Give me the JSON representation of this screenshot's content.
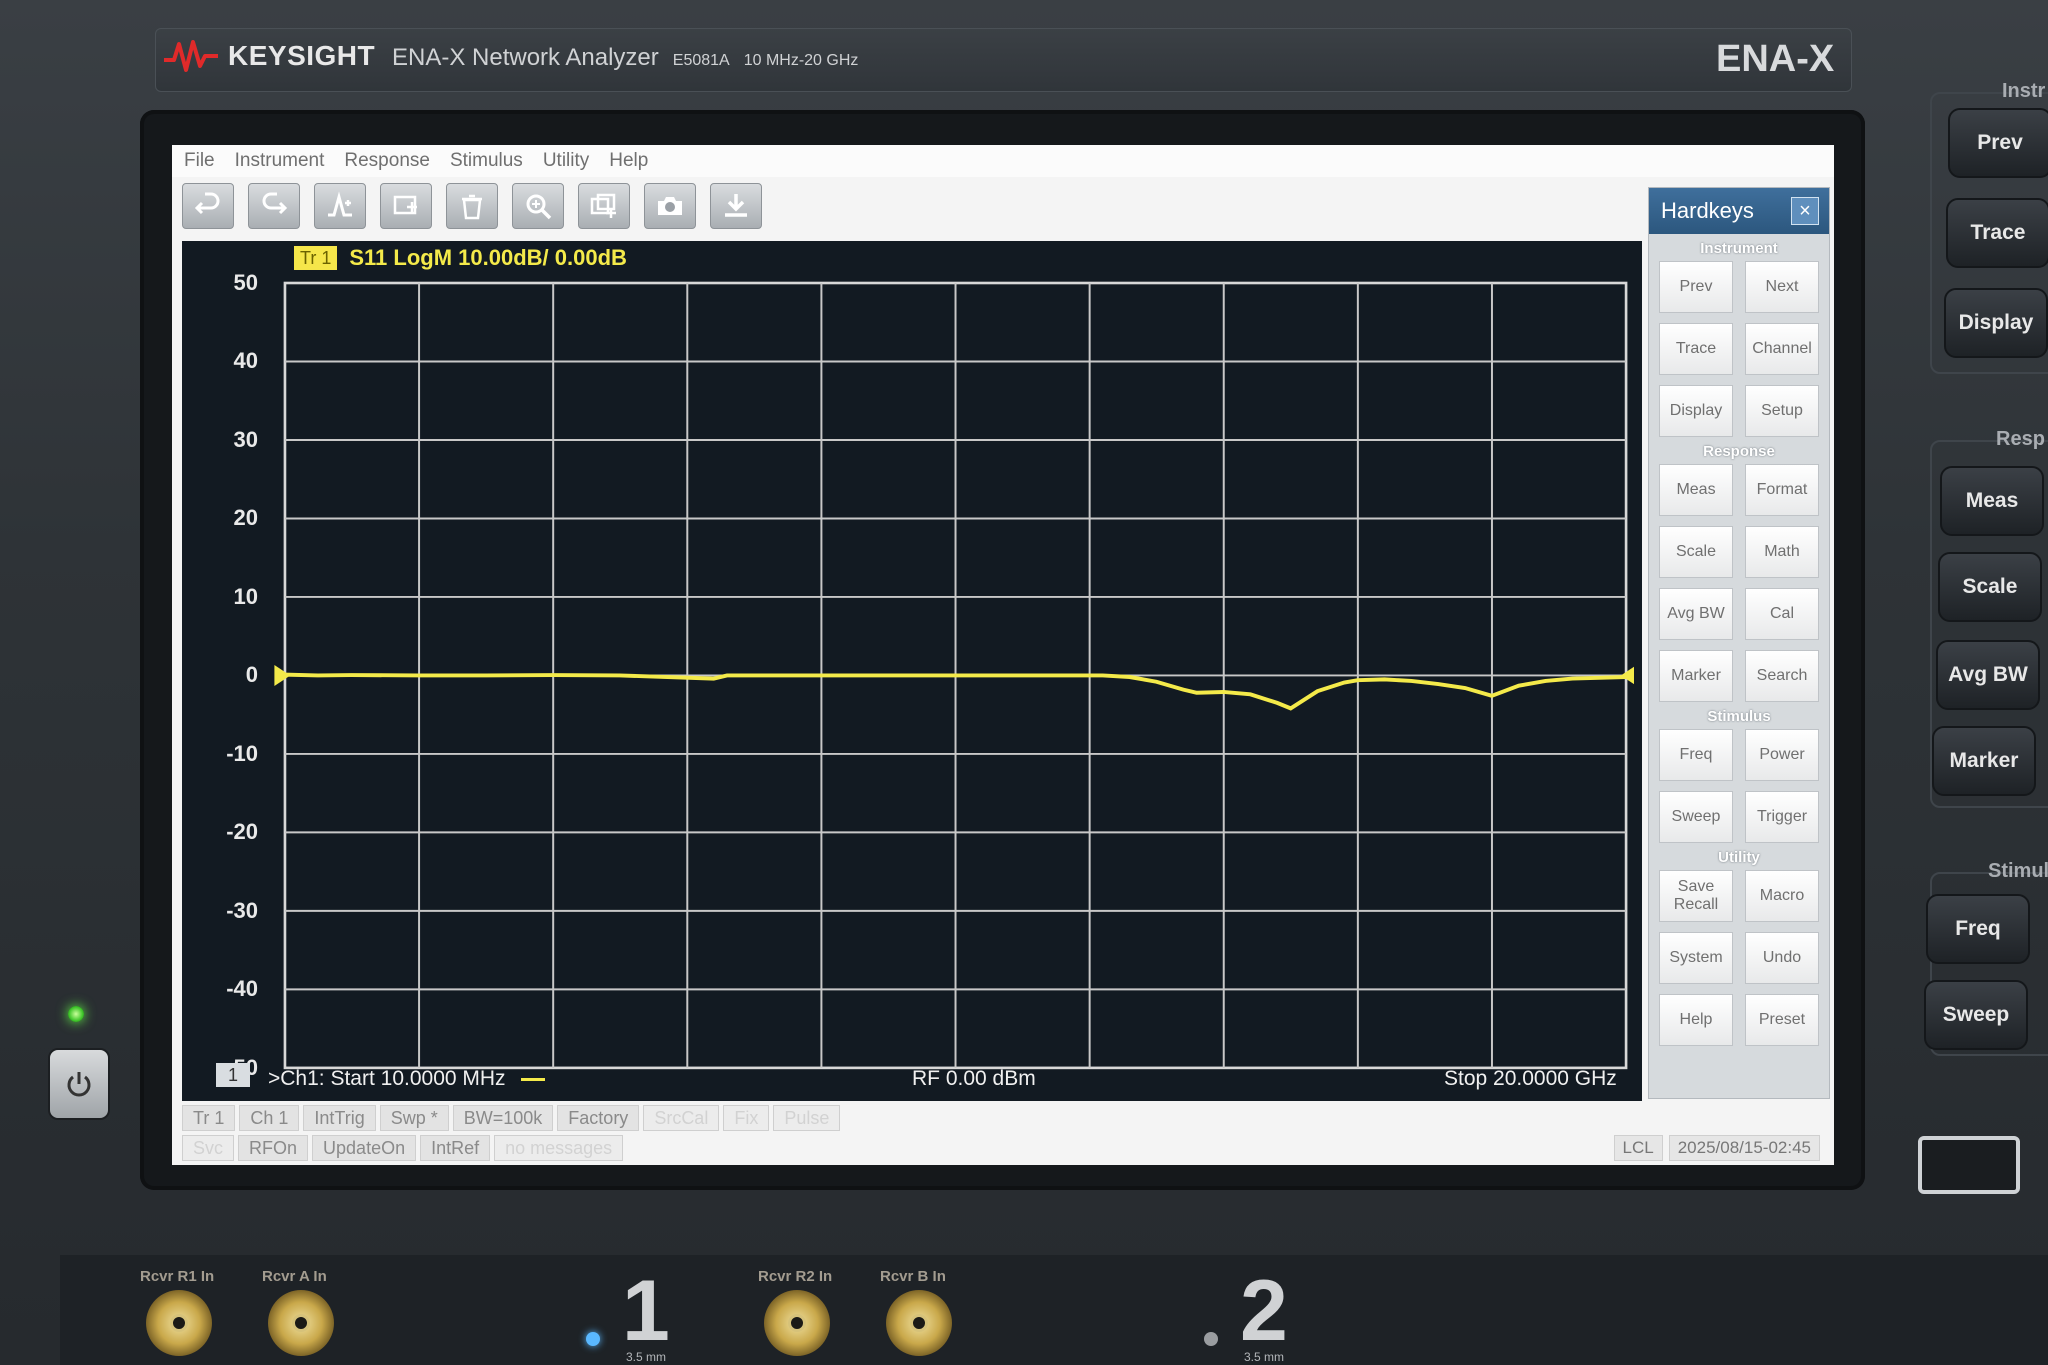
{
  "header": {
    "brand": "KEYSIGHT",
    "product": "ENA-X Network Analyzer",
    "model": "E5081A",
    "range": "10 MHz-20 GHz",
    "series": "ENA-X"
  },
  "menu": [
    "File",
    "Instrument",
    "Response",
    "Stimulus",
    "Utility",
    "Help"
  ],
  "toolbar": [
    "undo-icon",
    "redo-icon",
    "marker-icon",
    "channel-icon",
    "trash-icon",
    "zoom-icon",
    "copy-channel-icon",
    "camera-icon",
    "download-icon"
  ],
  "trace": {
    "badge": "Tr 1",
    "title": "S11 LogM 10.00dB/ 0.00dB",
    "color": "#f4ea4a"
  },
  "plot_footer": {
    "channel_badge": "1",
    "start": ">Ch1:  Start  10.0000 MHz",
    "rf": "RF    0.00 dBm",
    "stop": "Stop  20.0000 GHz"
  },
  "chart_data": {
    "type": "line",
    "yticks": [
      "50",
      "40",
      "30",
      "20",
      "10",
      "0",
      "-10",
      "-20",
      "-30",
      "-40",
      "-50"
    ],
    "ylim": [
      -50,
      50
    ],
    "xlim": [
      0.01,
      20
    ],
    "grid": true,
    "series": [
      {
        "x": [
          0.01,
          0.5,
          1,
          2,
          3,
          4,
          5,
          6.4,
          6.6,
          7,
          8,
          10,
          12,
          12.2,
          12.6,
          13,
          13.4,
          13.6,
          14,
          14.4,
          14.8,
          15,
          15.4,
          15.8,
          16,
          16.4,
          16.8,
          17.2,
          17.6,
          18,
          18.4,
          18.8,
          19.2,
          19.6,
          20
        ],
        "y": [
          0.1,
          0.0,
          0.05,
          0.0,
          0.0,
          0.05,
          0.0,
          -0.4,
          0.0,
          0.0,
          0.0,
          0.0,
          0.0,
          0.0,
          -0.2,
          -0.8,
          -1.8,
          -2.2,
          -2.1,
          -2.4,
          -3.5,
          -4.2,
          -2.0,
          -0.9,
          -0.6,
          -0.5,
          -0.7,
          -1.1,
          -1.6,
          -2.6,
          -1.3,
          -0.7,
          -0.4,
          -0.3,
          -0.2
        ]
      }
    ]
  },
  "status_row1": [
    {
      "text": "Tr 1",
      "dim": false
    },
    {
      "text": "Ch 1",
      "dim": false
    },
    {
      "text": "IntTrig",
      "dim": false
    },
    {
      "text": "Swp *",
      "dim": false
    },
    {
      "text": "BW=100k",
      "dim": false
    },
    {
      "text": "Factory",
      "dim": false
    },
    {
      "text": "SrcCal",
      "dim": true
    },
    {
      "text": "Fix",
      "dim": true
    },
    {
      "text": "Pulse",
      "dim": true
    }
  ],
  "status_row2": [
    {
      "text": "Svc",
      "dim": true
    },
    {
      "text": "RFOn",
      "dim": false
    },
    {
      "text": "UpdateOn",
      "dim": false
    },
    {
      "text": "IntRef",
      "dim": false
    },
    {
      "text": "no messages",
      "dim": true
    }
  ],
  "status_right": {
    "lcl": "LCL",
    "datetime": "2025/08/15-02:45"
  },
  "hardkeys": {
    "title": "Hardkeys",
    "close": "×",
    "sections": [
      {
        "name": "Instrument",
        "keys": [
          "Prev",
          "Next",
          "Trace",
          "Channel",
          "Display",
          "Setup"
        ]
      },
      {
        "name": "Response",
        "keys": [
          "Meas",
          "Format",
          "Scale",
          "Math",
          "Avg BW",
          "Cal",
          "Marker",
          "Search"
        ]
      },
      {
        "name": "Stimulus",
        "keys": [
          "Freq",
          "Power",
          "Sweep",
          "Trigger"
        ]
      },
      {
        "name": "Utility",
        "keys": [
          "Save Recall",
          "Macro",
          "System",
          "Undo",
          "Help",
          "Preset"
        ]
      }
    ]
  },
  "side_panel": {
    "labels": [
      "Instr",
      "Resp",
      "Stimul"
    ],
    "keys": [
      "Prev",
      "Trace",
      "Display",
      "Meas",
      "Scale",
      "Avg BW",
      "Marker",
      "Freq",
      "Sweep"
    ]
  },
  "ports": {
    "labels": [
      "Rcvr R1 In",
      "Rcvr A In",
      "Rcvr R2 In",
      "Rcvr B In"
    ],
    "numbers": [
      "1",
      "2"
    ],
    "subs": [
      "3.5 mm",
      "3.5 mm"
    ]
  }
}
